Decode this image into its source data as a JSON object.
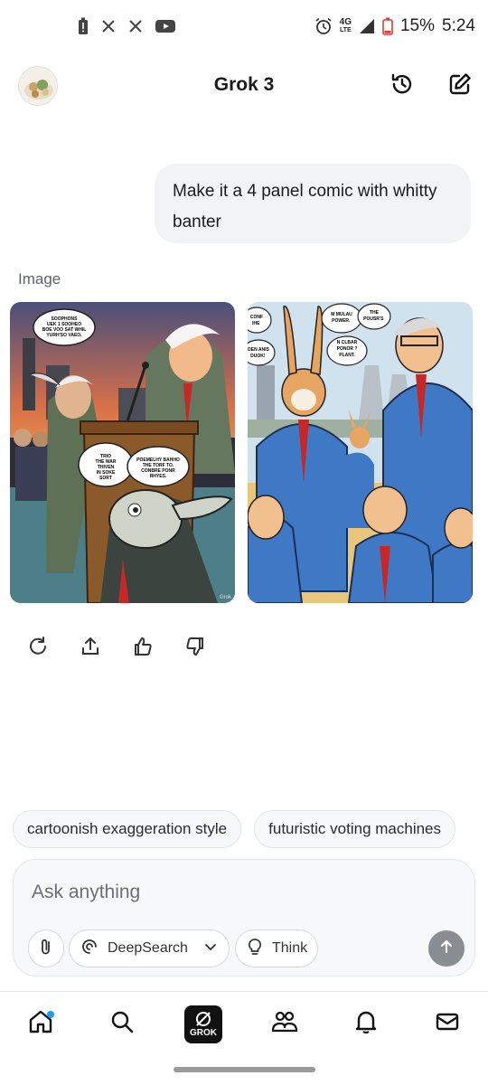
{
  "status_bar": {
    "time": "5:24",
    "battery": "15%",
    "network": "4G",
    "network_sub": "LTE",
    "left_icons": [
      "battery-alert-icon",
      "x-app-icon",
      "x-app-icon",
      "youtube-icon"
    ],
    "right_icons": [
      "alarm-icon",
      "signal-icon",
      "battery-icon"
    ]
  },
  "header": {
    "title": "Grok 3",
    "avatar_icon": "avatar-image",
    "history_icon": "history-icon",
    "new_chat_icon": "edit-icon"
  },
  "conversation": {
    "user_message": "Make it a 4 panel comic with whitty banter",
    "response_label": "Image",
    "images": [
      {
        "name": "comic-panel-politicians-rabbit",
        "speech_bubbles": [
          "SOOPHONS UEK 1 SOOHEO BOE VOO SAT WHIL YURH'SO VAEO.",
          "TRIO THE WAR THIVEN IN SOKE SORT",
          "POEMELHY BAHHO THE TORF TO. CONBRE PONR RHYES."
        ],
        "watermark": "Grok"
      },
      {
        "name": "comic-panel-rabbit-power-plant",
        "speech_bubbles": [
          "CONF IHE",
          "M MULAU POWER.",
          "THE POUSR'S",
          "DEN ANIS DUOK!",
          "N CLBAR PONOR ? PLANT."
        ]
      }
    ],
    "actions": [
      "regenerate-icon",
      "share-icon",
      "thumbs-up-icon",
      "thumbs-down-icon"
    ]
  },
  "suggestions": [
    "cartoonish exaggeration style",
    "futuristic voting machines"
  ],
  "composer": {
    "placeholder": "Ask anything",
    "attach_icon": "paperclip-icon",
    "deepsearch_label": "DeepSearch",
    "think_label": "Think",
    "send_icon": "arrow-up-icon"
  },
  "bottom_nav": {
    "items": [
      "home-icon",
      "search-icon",
      "grok-icon",
      "people-icon",
      "bell-icon",
      "mail-icon"
    ],
    "grok_label": "GROK",
    "accent": "#1d9bf0"
  }
}
